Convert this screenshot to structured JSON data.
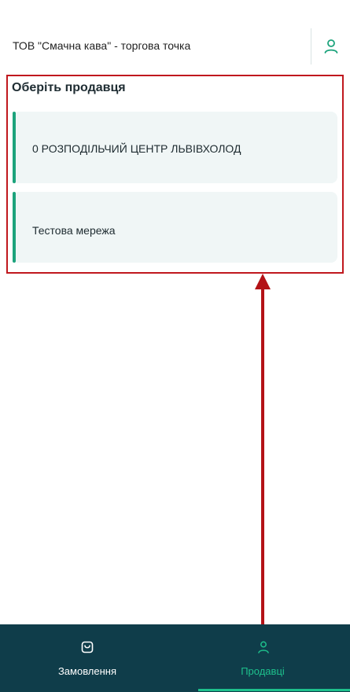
{
  "header": {
    "title": "ТОВ \"Смачна кава\" - торгова точка",
    "user_icon": "user-icon"
  },
  "sellers": {
    "title": "Оберіть продавця",
    "items": [
      {
        "label": "0 РОЗПОДІЛЬЧИЙ ЦЕНТР ЛЬВІВХОЛОД"
      },
      {
        "label": "Тестова мережа"
      }
    ]
  },
  "tabbar": {
    "tabs": [
      {
        "label": "Замовлення",
        "icon": "shopping-bag-icon",
        "active": false
      },
      {
        "label": "Продавці",
        "icon": "user-icon",
        "active": true
      }
    ]
  },
  "colors": {
    "accent": "#1ca37c",
    "tabbar_bg": "#0f3d4a",
    "active_tab": "#1ec08c",
    "card_bg": "#f0f6f6",
    "annotation": "#c0181e"
  }
}
